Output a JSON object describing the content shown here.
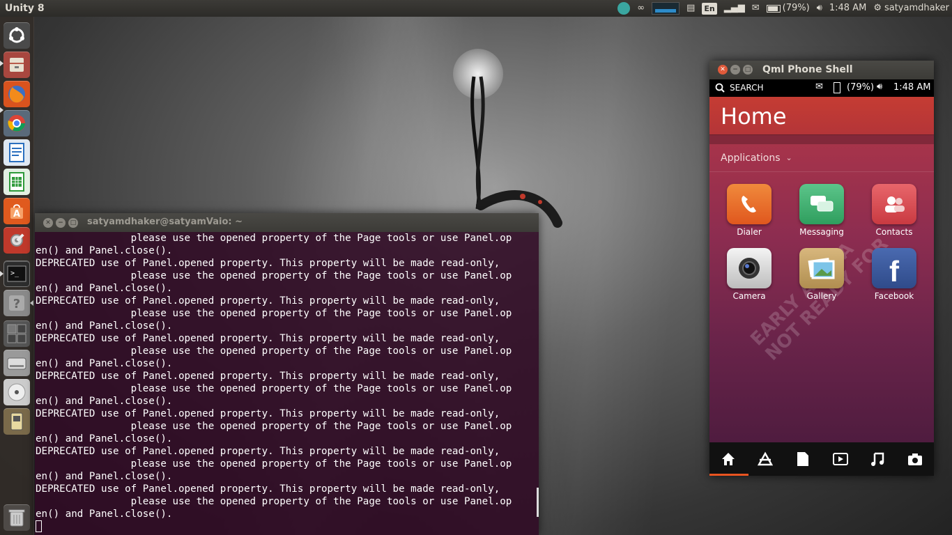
{
  "top_panel": {
    "title": "Unity 8",
    "keyboard_lang": "En",
    "battery_text": "(79%)",
    "clock": "1:48 AM",
    "user": "satyamdhaker"
  },
  "launcher": {
    "items": [
      {
        "name": "dash-home",
        "icon": "ubuntu-logo-icon",
        "color": "#5a5a5a"
      },
      {
        "name": "files",
        "icon": "file-cabinet-icon",
        "color": "#b0524a"
      },
      {
        "name": "firefox",
        "icon": "firefox-icon",
        "color": "#e66000"
      },
      {
        "name": "chrome",
        "icon": "chrome-icon",
        "color": "#4285f4"
      },
      {
        "name": "writer",
        "icon": "writer-document-icon",
        "color": "#2a6fbf"
      },
      {
        "name": "calc",
        "icon": "calc-spreadsheet-icon",
        "color": "#2e9a3a"
      },
      {
        "name": "software-center",
        "icon": "shopping-bag-icon",
        "color": "#e05a1e"
      },
      {
        "name": "system-settings",
        "icon": "settings-wrench-icon",
        "color": "#c0392b"
      },
      {
        "name": "terminal",
        "icon": "terminal-icon",
        "color": "#2d2d2d"
      },
      {
        "name": "unknown-app",
        "icon": "question-mark-icon",
        "color": "#8a8a8a"
      },
      {
        "name": "workspace-switcher",
        "icon": "workspace-icon",
        "color": "#555555"
      },
      {
        "name": "drive",
        "icon": "hard-drive-icon",
        "color": "#9a9a9a"
      },
      {
        "name": "cd-drive",
        "icon": "disc-icon",
        "color": "#bbbbbb"
      },
      {
        "name": "usb-device",
        "icon": "usb-device-icon",
        "color": "#7a6a4a"
      }
    ],
    "trash_icon": "trash-icon"
  },
  "terminal": {
    "title": "satyamdhaker@satyamVaio: ~",
    "lines": [
      "                please use the opened property of the Page tools or use Panel.op",
      "en() and Panel.close().",
      "DEPRECATED use of Panel.opened property. This property will be made read-only,",
      "                please use the opened property of the Page tools or use Panel.op",
      "en() and Panel.close().",
      "DEPRECATED use of Panel.opened property. This property will be made read-only,",
      "                please use the opened property of the Page tools or use Panel.op",
      "en() and Panel.close().",
      "DEPRECATED use of Panel.opened property. This property will be made read-only,",
      "                please use the opened property of the Page tools or use Panel.op",
      "en() and Panel.close().",
      "DEPRECATED use of Panel.opened property. This property will be made read-only,",
      "                please use the opened property of the Page tools or use Panel.op",
      "en() and Panel.close().",
      "DEPRECATED use of Panel.opened property. This property will be made read-only,",
      "                please use the opened property of the Page tools or use Panel.op",
      "en() and Panel.close().",
      "DEPRECATED use of Panel.opened property. This property will be made read-only,",
      "                please use the opened property of the Page tools or use Panel.op",
      "en() and Panel.close().",
      "DEPRECATED use of Panel.opened property. This property will be made read-only,",
      "                please use the opened property of the Page tools or use Panel.op",
      "en() and Panel.close()."
    ]
  },
  "phone": {
    "window_title": "Qml Phone Shell",
    "search_label": "SEARCH",
    "battery_text": "(79%)",
    "clock": "1:48 AM",
    "home_title": "Home",
    "section_label": "Applications",
    "watermark": "EARLY ALPHA\nNOT READY FOR",
    "apps": [
      {
        "label": "Dialer",
        "icon": "phone-icon",
        "color": "#e8641e"
      },
      {
        "label": "Messaging",
        "icon": "chat-bubbles-icon",
        "color": "#3bab6b"
      },
      {
        "label": "Contacts",
        "icon": "contacts-icon",
        "color": "#d9454b"
      },
      {
        "label": "Camera",
        "icon": "camera-icon",
        "color": "#e0e0e0"
      },
      {
        "label": "Gallery",
        "icon": "gallery-icon",
        "color": "#c9a46a"
      },
      {
        "label": "Facebook",
        "icon": "facebook-icon",
        "color": "#3b5998"
      }
    ],
    "nav": [
      "home-icon",
      "apps-icon",
      "files-icon",
      "video-icon",
      "music-icon",
      "camera-icon"
    ]
  }
}
